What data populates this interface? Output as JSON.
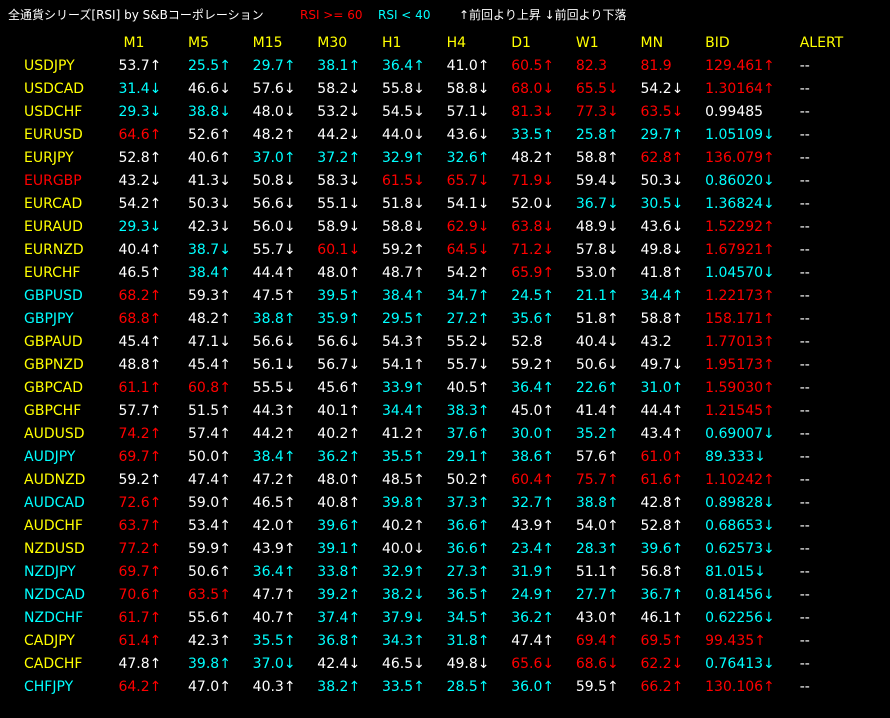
{
  "header": {
    "title": "全通貨シリーズ[RSI] by S&Bコーポレーション",
    "rsi_high": "RSI >= 60",
    "rsi_low": "RSI < 40",
    "legend": "↑前回より上昇 ↓前回より下落"
  },
  "colors": {
    "white": "#ffffff",
    "red": "#ff0000",
    "cyan": "#00ffff",
    "yellow": "#ffff00",
    "background": "#000000"
  },
  "columns": [
    "M1",
    "M5",
    "M15",
    "M30",
    "H1",
    "H4",
    "D1",
    "W1",
    "MN",
    "BID",
    "ALERT"
  ],
  "rows": [
    {
      "symbol": "USDJPY",
      "sym_color": "y",
      "cells": [
        [
          "53.7↑",
          "w"
        ],
        [
          "25.5↑",
          "c"
        ],
        [
          "29.7↑",
          "c"
        ],
        [
          "38.1↑",
          "c"
        ],
        [
          "36.4↑",
          "c"
        ],
        [
          "41.0↑",
          "w"
        ],
        [
          "60.5↑",
          "r"
        ],
        [
          "82.3",
          "r"
        ],
        [
          "81.9",
          "r"
        ],
        [
          "129.461↑",
          "r"
        ]
      ],
      "alert": "--"
    },
    {
      "symbol": "USDCAD",
      "sym_color": "y",
      "cells": [
        [
          "31.4↓",
          "c"
        ],
        [
          "46.6↓",
          "w"
        ],
        [
          "57.6↓",
          "w"
        ],
        [
          "58.2↓",
          "w"
        ],
        [
          "55.8↓",
          "w"
        ],
        [
          "58.8↓",
          "w"
        ],
        [
          "68.0↓",
          "r"
        ],
        [
          "65.5↓",
          "r"
        ],
        [
          "54.2↓",
          "w"
        ],
        [
          "1.30164↑",
          "r"
        ]
      ],
      "alert": "--"
    },
    {
      "symbol": "USDCHF",
      "sym_color": "y",
      "cells": [
        [
          "29.3↓",
          "c"
        ],
        [
          "38.8↓",
          "c"
        ],
        [
          "48.0↓",
          "w"
        ],
        [
          "53.2↓",
          "w"
        ],
        [
          "54.5↓",
          "w"
        ],
        [
          "57.1↓",
          "w"
        ],
        [
          "81.3↓",
          "r"
        ],
        [
          "77.3↓",
          "r"
        ],
        [
          "63.5↓",
          "r"
        ],
        [
          "0.99485",
          "w"
        ]
      ],
      "alert": "--"
    },
    {
      "symbol": "EURUSD",
      "sym_color": "y",
      "cells": [
        [
          "64.6↑",
          "r"
        ],
        [
          "52.6↑",
          "w"
        ],
        [
          "48.2↑",
          "w"
        ],
        [
          "44.2↓",
          "w"
        ],
        [
          "44.0↓",
          "w"
        ],
        [
          "43.6↓",
          "w"
        ],
        [
          "33.5↑",
          "c"
        ],
        [
          "25.8↑",
          "c"
        ],
        [
          "29.7↑",
          "c"
        ],
        [
          "1.05109↓",
          "c"
        ]
      ],
      "alert": "--"
    },
    {
      "symbol": "EURJPY",
      "sym_color": "y",
      "cells": [
        [
          "52.8↑",
          "w"
        ],
        [
          "40.6↑",
          "w"
        ],
        [
          "37.0↑",
          "c"
        ],
        [
          "37.2↑",
          "c"
        ],
        [
          "32.9↑",
          "c"
        ],
        [
          "32.6↑",
          "c"
        ],
        [
          "48.2↑",
          "w"
        ],
        [
          "58.8↑",
          "w"
        ],
        [
          "62.8↑",
          "r"
        ],
        [
          "136.079↑",
          "r"
        ]
      ],
      "alert": "--"
    },
    {
      "symbol": "EURGBP",
      "sym_color": "r",
      "cells": [
        [
          "43.2↓",
          "w"
        ],
        [
          "41.3↓",
          "w"
        ],
        [
          "50.8↓",
          "w"
        ],
        [
          "58.3↓",
          "w"
        ],
        [
          "61.5↓",
          "r"
        ],
        [
          "65.7↓",
          "r"
        ],
        [
          "71.9↓",
          "r"
        ],
        [
          "59.4↓",
          "w"
        ],
        [
          "50.3↓",
          "w"
        ],
        [
          "0.86020↓",
          "c"
        ]
      ],
      "alert": "--"
    },
    {
      "symbol": "EURCAD",
      "sym_color": "y",
      "cells": [
        [
          "54.2↑",
          "w"
        ],
        [
          "50.3↓",
          "w"
        ],
        [
          "56.6↓",
          "w"
        ],
        [
          "55.1↓",
          "w"
        ],
        [
          "51.8↓",
          "w"
        ],
        [
          "54.1↓",
          "w"
        ],
        [
          "52.0↓",
          "w"
        ],
        [
          "36.7↓",
          "c"
        ],
        [
          "30.5↓",
          "c"
        ],
        [
          "1.36824↓",
          "c"
        ]
      ],
      "alert": "--"
    },
    {
      "symbol": "EURAUD",
      "sym_color": "y",
      "cells": [
        [
          "29.3↓",
          "c"
        ],
        [
          "42.3↓",
          "w"
        ],
        [
          "56.0↓",
          "w"
        ],
        [
          "58.9↓",
          "w"
        ],
        [
          "58.8↓",
          "w"
        ],
        [
          "62.9↓",
          "r"
        ],
        [
          "63.8↓",
          "r"
        ],
        [
          "48.9↓",
          "w"
        ],
        [
          "43.6↓",
          "w"
        ],
        [
          "1.52292↑",
          "r"
        ]
      ],
      "alert": "--"
    },
    {
      "symbol": "EURNZD",
      "sym_color": "y",
      "cells": [
        [
          "40.4↑",
          "w"
        ],
        [
          "38.7↓",
          "c"
        ],
        [
          "55.7↓",
          "w"
        ],
        [
          "60.1↓",
          "r"
        ],
        [
          "59.2↑",
          "w"
        ],
        [
          "64.5↓",
          "r"
        ],
        [
          "71.2↓",
          "r"
        ],
        [
          "57.8↓",
          "w"
        ],
        [
          "49.8↓",
          "w"
        ],
        [
          "1.67921↑",
          "r"
        ]
      ],
      "alert": "--"
    },
    {
      "symbol": "EURCHF",
      "sym_color": "y",
      "cells": [
        [
          "46.5↑",
          "w"
        ],
        [
          "38.4↑",
          "c"
        ],
        [
          "44.4↑",
          "w"
        ],
        [
          "48.0↑",
          "w"
        ],
        [
          "48.7↑",
          "w"
        ],
        [
          "54.2↑",
          "w"
        ],
        [
          "65.9↑",
          "r"
        ],
        [
          "53.0↑",
          "w"
        ],
        [
          "41.8↑",
          "w"
        ],
        [
          "1.04570↓",
          "c"
        ]
      ],
      "alert": "--"
    },
    {
      "symbol": "GBPUSD",
      "sym_color": "c",
      "cells": [
        [
          "68.2↑",
          "r"
        ],
        [
          "59.3↑",
          "w"
        ],
        [
          "47.5↑",
          "w"
        ],
        [
          "39.5↑",
          "c"
        ],
        [
          "38.4↑",
          "c"
        ],
        [
          "34.7↑",
          "c"
        ],
        [
          "24.5↑",
          "c"
        ],
        [
          "21.1↑",
          "c"
        ],
        [
          "34.4↑",
          "c"
        ],
        [
          "1.22173↑",
          "r"
        ]
      ],
      "alert": "--"
    },
    {
      "symbol": "GBPJPY",
      "sym_color": "c",
      "cells": [
        [
          "68.8↑",
          "r"
        ],
        [
          "48.2↑",
          "w"
        ],
        [
          "38.8↑",
          "c"
        ],
        [
          "35.9↑",
          "c"
        ],
        [
          "29.5↑",
          "c"
        ],
        [
          "27.2↑",
          "c"
        ],
        [
          "35.6↑",
          "c"
        ],
        [
          "51.8↑",
          "w"
        ],
        [
          "58.8↑",
          "w"
        ],
        [
          "158.171↑",
          "r"
        ]
      ],
      "alert": "--"
    },
    {
      "symbol": "GBPAUD",
      "sym_color": "y",
      "cells": [
        [
          "45.4↑",
          "w"
        ],
        [
          "47.1↓",
          "w"
        ],
        [
          "56.6↓",
          "w"
        ],
        [
          "56.6↓",
          "w"
        ],
        [
          "54.3↑",
          "w"
        ],
        [
          "55.2↓",
          "w"
        ],
        [
          "52.8",
          "w"
        ],
        [
          "40.4↓",
          "w"
        ],
        [
          "43.2",
          "w"
        ],
        [
          "1.77013↑",
          "r"
        ]
      ],
      "alert": "--"
    },
    {
      "symbol": "GBPNZD",
      "sym_color": "y",
      "cells": [
        [
          "48.8↑",
          "w"
        ],
        [
          "45.4↑",
          "w"
        ],
        [
          "56.1↓",
          "w"
        ],
        [
          "56.7↓",
          "w"
        ],
        [
          "54.1↑",
          "w"
        ],
        [
          "55.7↓",
          "w"
        ],
        [
          "59.2↑",
          "w"
        ],
        [
          "50.6↓",
          "w"
        ],
        [
          "49.7↓",
          "w"
        ],
        [
          "1.95173↑",
          "r"
        ]
      ],
      "alert": "--"
    },
    {
      "symbol": "GBPCAD",
      "sym_color": "y",
      "cells": [
        [
          "61.1↑",
          "r"
        ],
        [
          "60.8↑",
          "r"
        ],
        [
          "55.5↓",
          "w"
        ],
        [
          "45.6↑",
          "w"
        ],
        [
          "33.9↑",
          "c"
        ],
        [
          "40.5↑",
          "w"
        ],
        [
          "36.4↑",
          "c"
        ],
        [
          "22.6↑",
          "c"
        ],
        [
          "31.0↑",
          "c"
        ],
        [
          "1.59030↑",
          "r"
        ]
      ],
      "alert": "--"
    },
    {
      "symbol": "GBPCHF",
      "sym_color": "y",
      "cells": [
        [
          "57.7↑",
          "w"
        ],
        [
          "51.5↑",
          "w"
        ],
        [
          "44.3↑",
          "w"
        ],
        [
          "40.1↑",
          "w"
        ],
        [
          "34.4↑",
          "c"
        ],
        [
          "38.3↑",
          "c"
        ],
        [
          "45.0↑",
          "w"
        ],
        [
          "41.4↑",
          "w"
        ],
        [
          "44.4↑",
          "w"
        ],
        [
          "1.21545↑",
          "r"
        ]
      ],
      "alert": "--"
    },
    {
      "symbol": "AUDUSD",
      "sym_color": "y",
      "cells": [
        [
          "74.2↑",
          "r"
        ],
        [
          "57.4↑",
          "w"
        ],
        [
          "44.2↑",
          "w"
        ],
        [
          "40.2↑",
          "w"
        ],
        [
          "41.2↑",
          "w"
        ],
        [
          "37.6↑",
          "c"
        ],
        [
          "30.0↑",
          "c"
        ],
        [
          "35.2↑",
          "c"
        ],
        [
          "43.4↑",
          "w"
        ],
        [
          "0.69007↓",
          "c"
        ]
      ],
      "alert": "--"
    },
    {
      "symbol": "AUDJPY",
      "sym_color": "c",
      "cells": [
        [
          "69.7↑",
          "r"
        ],
        [
          "50.0↑",
          "w"
        ],
        [
          "38.4↑",
          "c"
        ],
        [
          "36.2↑",
          "c"
        ],
        [
          "35.5↑",
          "c"
        ],
        [
          "29.1↑",
          "c"
        ],
        [
          "38.6↑",
          "c"
        ],
        [
          "57.6↑",
          "w"
        ],
        [
          "61.0↑",
          "r"
        ],
        [
          "89.333↓",
          "c"
        ]
      ],
      "alert": "--"
    },
    {
      "symbol": "AUDNZD",
      "sym_color": "y",
      "cells": [
        [
          "59.2↑",
          "w"
        ],
        [
          "47.4↑",
          "w"
        ],
        [
          "47.2↑",
          "w"
        ],
        [
          "48.0↑",
          "w"
        ],
        [
          "48.5↑",
          "w"
        ],
        [
          "50.2↑",
          "w"
        ],
        [
          "60.4↑",
          "r"
        ],
        [
          "75.7↑",
          "r"
        ],
        [
          "61.6↑",
          "r"
        ],
        [
          "1.10242↑",
          "r"
        ]
      ],
      "alert": "--"
    },
    {
      "symbol": "AUDCAD",
      "sym_color": "c",
      "cells": [
        [
          "72.6↑",
          "r"
        ],
        [
          "59.0↑",
          "w"
        ],
        [
          "46.5↑",
          "w"
        ],
        [
          "40.8↑",
          "w"
        ],
        [
          "39.8↑",
          "c"
        ],
        [
          "37.3↑",
          "c"
        ],
        [
          "32.7↑",
          "c"
        ],
        [
          "38.8↑",
          "c"
        ],
        [
          "42.8↑",
          "w"
        ],
        [
          "0.89828↓",
          "c"
        ]
      ],
      "alert": "--"
    },
    {
      "symbol": "AUDCHF",
      "sym_color": "y",
      "cells": [
        [
          "63.7↑",
          "r"
        ],
        [
          "53.4↑",
          "w"
        ],
        [
          "42.0↑",
          "w"
        ],
        [
          "39.6↑",
          "c"
        ],
        [
          "40.2↑",
          "w"
        ],
        [
          "36.6↑",
          "c"
        ],
        [
          "43.9↑",
          "w"
        ],
        [
          "54.0↑",
          "w"
        ],
        [
          "52.8↑",
          "w"
        ],
        [
          "0.68653↓",
          "c"
        ]
      ],
      "alert": "--"
    },
    {
      "symbol": "NZDUSD",
      "sym_color": "y",
      "cells": [
        [
          "77.2↑",
          "r"
        ],
        [
          "59.9↑",
          "w"
        ],
        [
          "43.9↑",
          "w"
        ],
        [
          "39.1↑",
          "c"
        ],
        [
          "40.0↓",
          "w"
        ],
        [
          "36.6↑",
          "c"
        ],
        [
          "23.4↑",
          "c"
        ],
        [
          "28.3↑",
          "c"
        ],
        [
          "39.6↑",
          "c"
        ],
        [
          "0.62573↓",
          "c"
        ]
      ],
      "alert": "--"
    },
    {
      "symbol": "NZDJPY",
      "sym_color": "c",
      "cells": [
        [
          "69.7↑",
          "r"
        ],
        [
          "50.6↑",
          "w"
        ],
        [
          "36.4↑",
          "c"
        ],
        [
          "33.8↑",
          "c"
        ],
        [
          "32.9↑",
          "c"
        ],
        [
          "27.3↑",
          "c"
        ],
        [
          "31.9↑",
          "c"
        ],
        [
          "51.1↑",
          "w"
        ],
        [
          "56.8↑",
          "w"
        ],
        [
          "81.015↓",
          "c"
        ]
      ],
      "alert": "--"
    },
    {
      "symbol": "NZDCAD",
      "sym_color": "c",
      "cells": [
        [
          "70.6↑",
          "r"
        ],
        [
          "63.5↑",
          "r"
        ],
        [
          "47.7↑",
          "w"
        ],
        [
          "39.2↑",
          "c"
        ],
        [
          "38.2↓",
          "c"
        ],
        [
          "36.5↑",
          "c"
        ],
        [
          "24.9↑",
          "c"
        ],
        [
          "27.7↑",
          "c"
        ],
        [
          "36.7↑",
          "c"
        ],
        [
          "0.81456↓",
          "c"
        ]
      ],
      "alert": "--"
    },
    {
      "symbol": "NZDCHF",
      "sym_color": "c",
      "cells": [
        [
          "61.7↑",
          "r"
        ],
        [
          "55.6↑",
          "w"
        ],
        [
          "40.7↑",
          "w"
        ],
        [
          "37.4↑",
          "c"
        ],
        [
          "37.9↓",
          "c"
        ],
        [
          "34.5↑",
          "c"
        ],
        [
          "36.2↑",
          "c"
        ],
        [
          "43.0↑",
          "w"
        ],
        [
          "46.1↑",
          "w"
        ],
        [
          "0.62256↓",
          "c"
        ]
      ],
      "alert": "--"
    },
    {
      "symbol": "CADJPY",
      "sym_color": "y",
      "cells": [
        [
          "61.4↑",
          "r"
        ],
        [
          "42.3↑",
          "w"
        ],
        [
          "35.5↑",
          "c"
        ],
        [
          "36.8↑",
          "c"
        ],
        [
          "34.3↑",
          "c"
        ],
        [
          "31.8↑",
          "c"
        ],
        [
          "47.4↑",
          "w"
        ],
        [
          "69.4↑",
          "r"
        ],
        [
          "69.5↑",
          "r"
        ],
        [
          "99.435↑",
          "r"
        ]
      ],
      "alert": "--"
    },
    {
      "symbol": "CADCHF",
      "sym_color": "y",
      "cells": [
        [
          "47.8↑",
          "w"
        ],
        [
          "39.8↑",
          "c"
        ],
        [
          "37.0↓",
          "c"
        ],
        [
          "42.4↓",
          "w"
        ],
        [
          "46.5↓",
          "w"
        ],
        [
          "49.8↓",
          "w"
        ],
        [
          "65.6↓",
          "r"
        ],
        [
          "68.6↓",
          "r"
        ],
        [
          "62.2↓",
          "r"
        ],
        [
          "0.76413↓",
          "c"
        ]
      ],
      "alert": "--"
    },
    {
      "symbol": "CHFJPY",
      "sym_color": "c",
      "cells": [
        [
          "64.2↑",
          "r"
        ],
        [
          "47.0↑",
          "w"
        ],
        [
          "40.3↑",
          "w"
        ],
        [
          "38.2↑",
          "c"
        ],
        [
          "33.5↑",
          "c"
        ],
        [
          "28.5↑",
          "c"
        ],
        [
          "36.0↑",
          "c"
        ],
        [
          "59.5↑",
          "w"
        ],
        [
          "66.2↑",
          "r"
        ],
        [
          "130.106↑",
          "r"
        ]
      ],
      "alert": "--"
    }
  ]
}
